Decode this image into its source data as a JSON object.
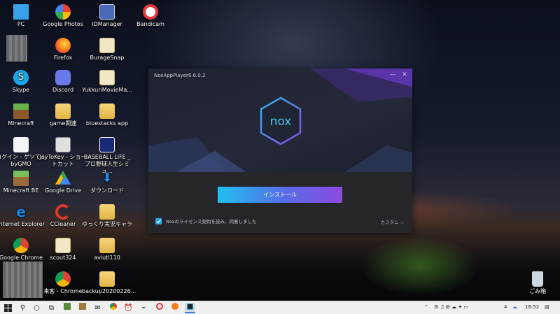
{
  "desktop": {
    "icons": [
      {
        "label": "PC",
        "icon": "pc-icon",
        "color": "#3aa0e8"
      },
      {
        "label": "Google Photos",
        "icon": "google-photos-icon",
        "color": "#f4b400"
      },
      {
        "label": "IDManager",
        "icon": "idmanager-icon",
        "color": "#4a6ab8"
      },
      {
        "label": "Bandicam",
        "icon": "bandicam-icon",
        "color": "#e23a3a"
      },
      {
        "label": "Firefox",
        "icon": "firefox-icon",
        "color": "#ff7a1a"
      },
      {
        "label": "BurageSnap",
        "icon": "file-icon",
        "color": "#f1e7c4"
      },
      {
        "label": "Skype",
        "icon": "skype-icon",
        "color": "#1aa8e8"
      },
      {
        "label": "Discord",
        "icon": "discord-icon",
        "color": "#6a7ae8"
      },
      {
        "label": "YukkuriMovieMa...",
        "icon": "file-icon",
        "color": "#f1e7c4"
      },
      {
        "label": "Minecraft",
        "icon": "minecraft-icon",
        "color": "#5a8a3a"
      },
      {
        "label": "game関連",
        "icon": "folder-icon",
        "color": "#e8c35a"
      },
      {
        "label": "bluestacks app",
        "icon": "folder-icon",
        "color": "#e8c35a"
      },
      {
        "label": "ログイン - ゲソてん byGMO",
        "icon": "gesoten-icon",
        "color": "#f0f0f0"
      },
      {
        "label": "JoyToKey - ショートカット",
        "icon": "joytokey-icon",
        "color": "#dcdcdc"
      },
      {
        "label": "BASEBALL LIFE _ プロ野球人生シミュ...",
        "icon": "baseball-life-icon",
        "color": "#1a2a7a"
      },
      {
        "label": "Minecraft BE",
        "icon": "minecraft-be-icon",
        "color": "#6a9a3a"
      },
      {
        "label": "Google Drive",
        "icon": "google-drive-icon",
        "color": "#34a853"
      },
      {
        "label": "ダウンロード",
        "icon": "download-icon",
        "color": "#2a8ae8"
      },
      {
        "label": "Internet Explorer",
        "icon": "internet-explorer-icon",
        "color": "#1a8ae8"
      },
      {
        "label": "CCleaner",
        "icon": "ccleaner-icon",
        "color": "#d83a2a"
      },
      {
        "label": "ゆっくり実況キャラ",
        "icon": "folder-icon",
        "color": "#e8c35a"
      },
      {
        "label": "Google Chrome",
        "icon": "chrome-icon",
        "color": "#db4437"
      },
      {
        "label": "scout324",
        "icon": "file-icon",
        "color": "#f1e7c4"
      },
      {
        "label": "aviutl110",
        "icon": "folder-icon",
        "color": "#e8c35a"
      },
      {
        "label": "来客 - Chrome",
        "icon": "chrome-icon",
        "color": "#db4437"
      },
      {
        "label": "backup20200226...",
        "icon": "folder-icon",
        "color": "#e8c35a"
      },
      {
        "label": "ごみ箱",
        "icon": "recycle-bin-icon",
        "color": "#cfd8e0"
      }
    ]
  },
  "nox": {
    "title": "NoxAppPlayer6.6.0.2",
    "logo_text": "nox",
    "install_label": "インストール",
    "license_text": "Noxのライセンス契約を読み、同意しました",
    "license_checked": true,
    "custom_label": "カスタム",
    "accent": "#29a8e8"
  },
  "taskbar": {
    "time": "16:52",
    "tray_notification_count": "4"
  }
}
